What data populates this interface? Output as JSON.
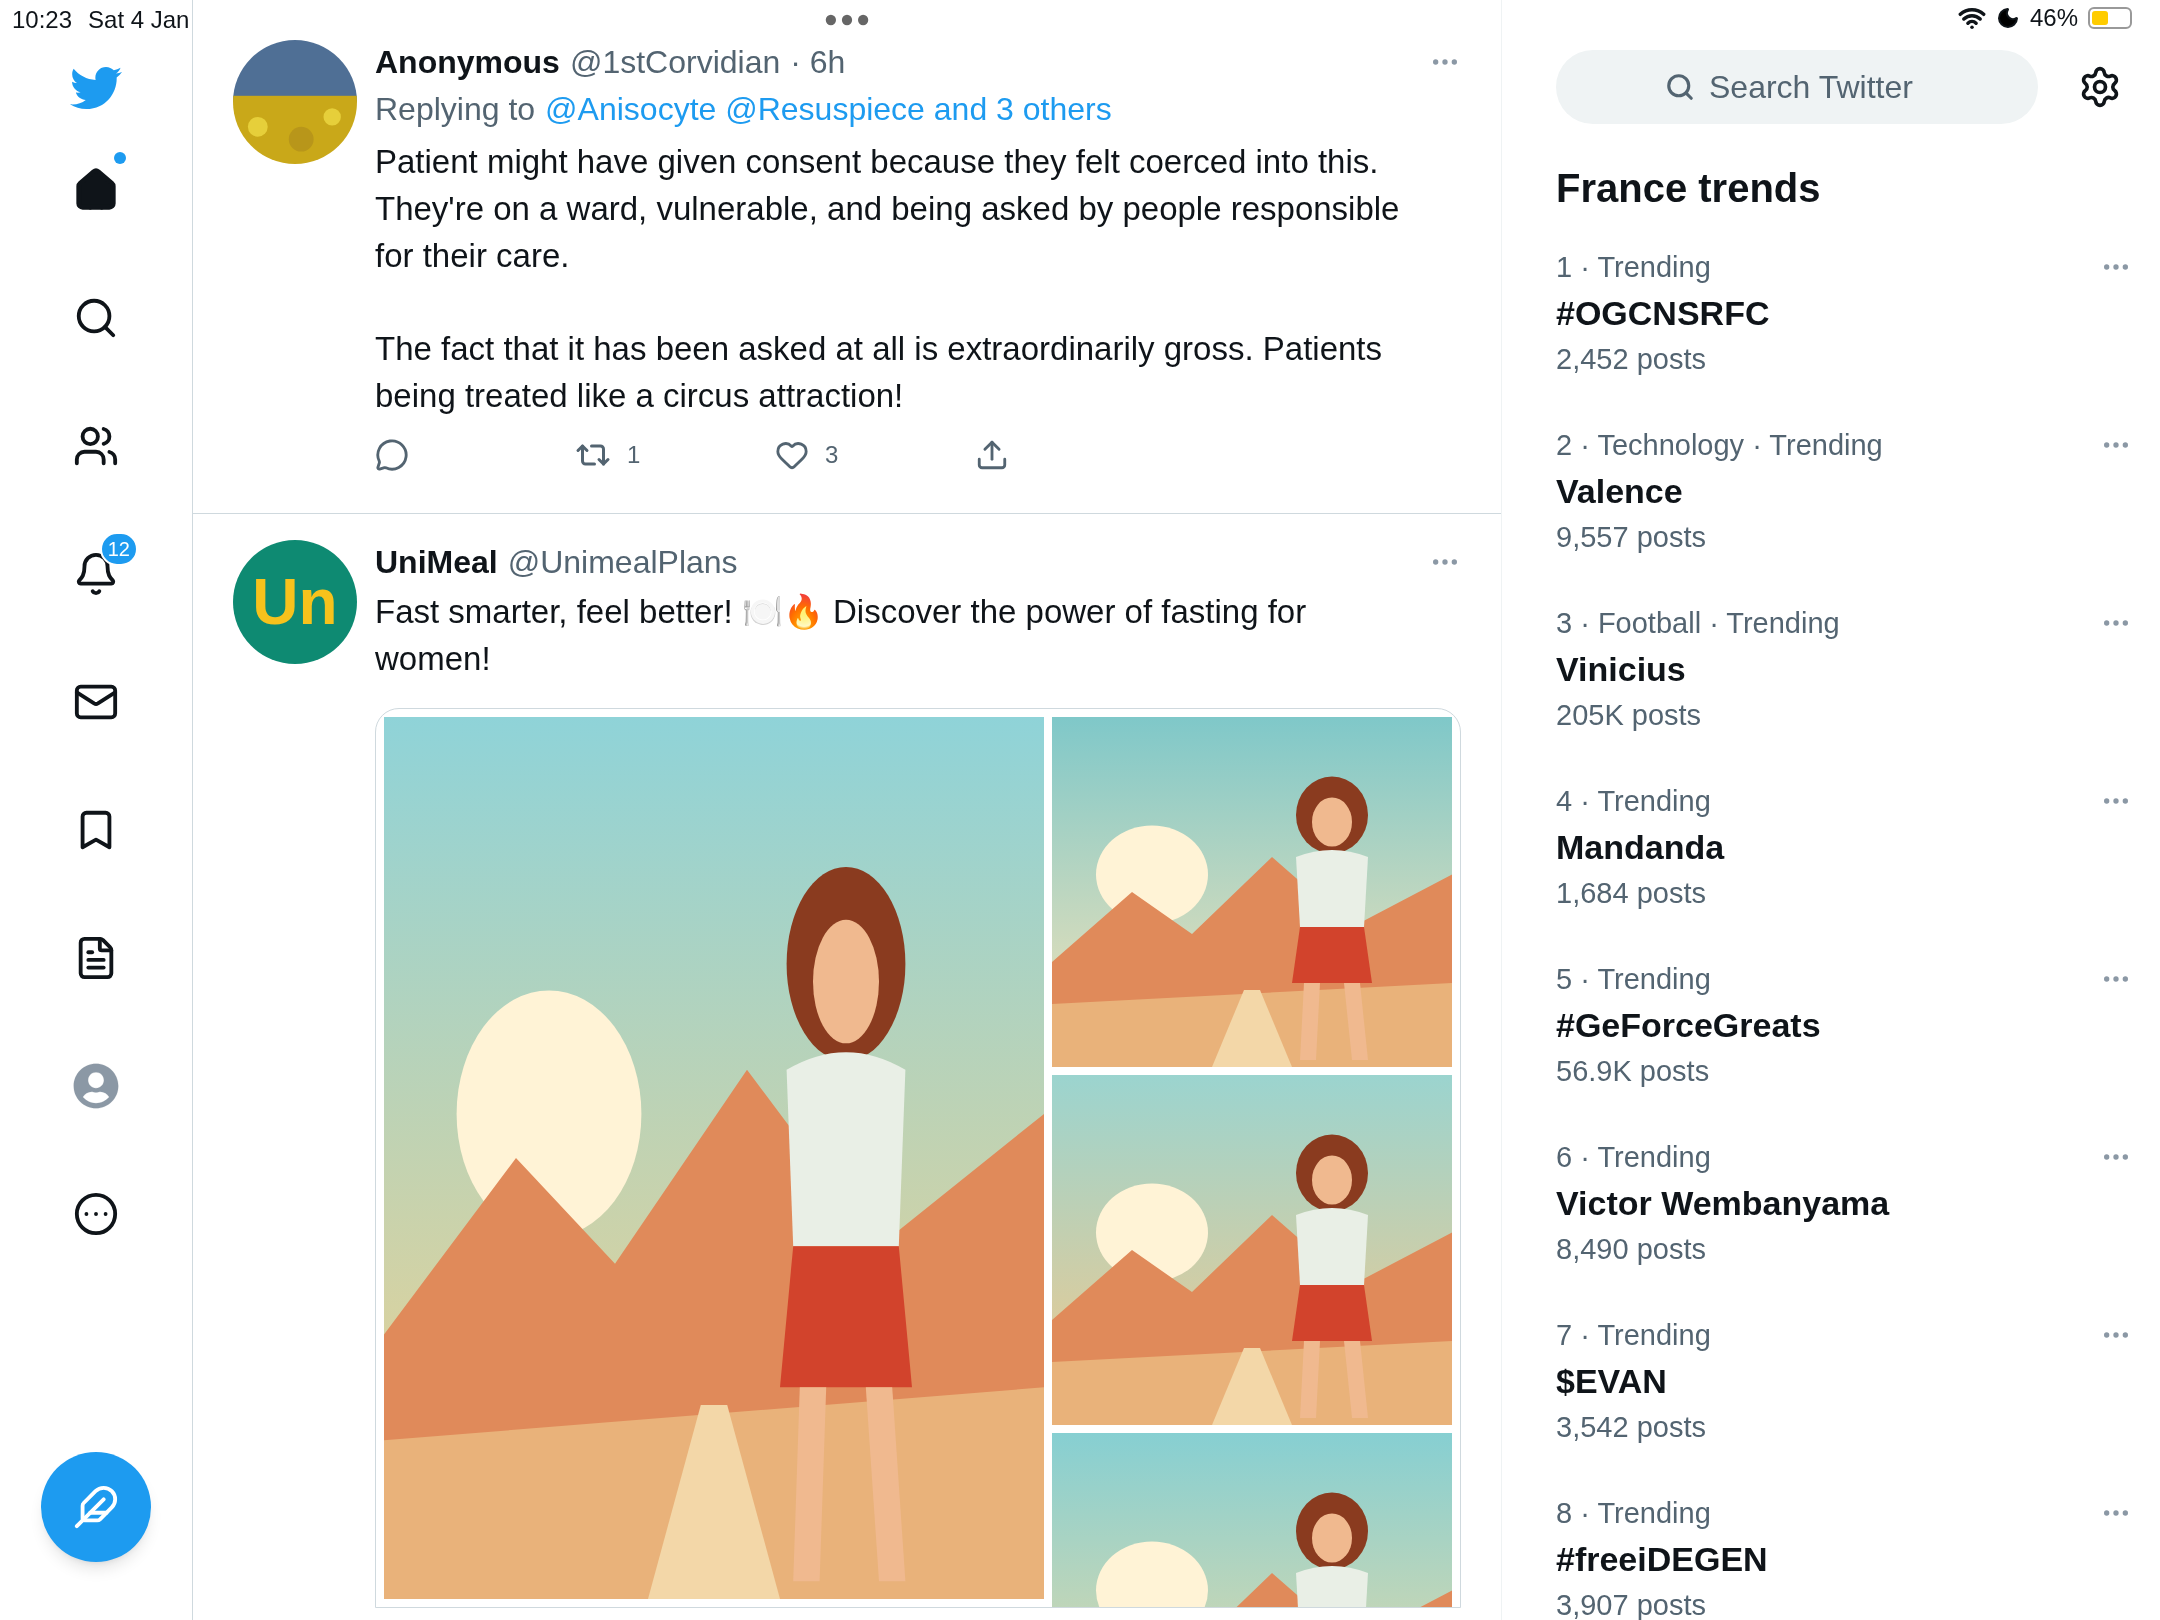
{
  "status_bar": {
    "time": "10:23",
    "date": "Sat 4 Jan",
    "battery": "46%"
  },
  "sidebar": {
    "items": [
      {
        "kind": "home",
        "selected": true,
        "dot": true
      },
      {
        "kind": "explore",
        "selected": false
      },
      {
        "kind": "communities",
        "selected": false
      },
      {
        "kind": "notifications",
        "selected": false,
        "badge": "12"
      },
      {
        "kind": "messages",
        "selected": false
      },
      {
        "kind": "bookmarks",
        "selected": false
      },
      {
        "kind": "lists",
        "selected": false
      },
      {
        "kind": "profile",
        "selected": false
      },
      {
        "kind": "more",
        "selected": false
      }
    ]
  },
  "tweets": [
    {
      "avatar": {
        "kind": "picture"
      },
      "name": "Anonymous",
      "handle": "@1stCorvidian",
      "time": "· 6h",
      "replying_label": "Replying to",
      "replying_to": "@Anisocyte @Resuspiece and 3 others",
      "paragraphs": [
        "Patient might have given consent because they felt coerced into this. They're on a ward, vulnerable, and being asked by people responsible for their care.",
        "The fact that it has been asked at all is extraordinarily gross. Patients being treated like a circus attraction!"
      ],
      "actions": {
        "retweets": "1",
        "likes": "3"
      }
    },
    {
      "avatar": {
        "kind": "logo",
        "text": "Un"
      },
      "name": "UniMeal",
      "handle": "@UnimealPlans",
      "paragraphs": [
        "Fast smarter, feel better! 🍽️🔥 Discover the power of fasting for women!"
      ],
      "media": [
        {
          "kind": "picture"
        },
        {
          "kind": "picture"
        },
        {
          "kind": "picture"
        },
        {
          "kind": "picture"
        }
      ]
    }
  ],
  "search": {
    "placeholder": "Search Twitter"
  },
  "trends": {
    "title": "France trends",
    "items": [
      {
        "meta": "1 · Trending",
        "name": "#OGCNSRFC",
        "posts": "2,452 posts"
      },
      {
        "meta": "2 · Technology · Trending",
        "name": "Valence",
        "posts": "9,557 posts"
      },
      {
        "meta": "3 · Football · Trending",
        "name": "Vinicius",
        "posts": "205K posts"
      },
      {
        "meta": "4 · Trending",
        "name": "Mandanda",
        "posts": "1,684 posts"
      },
      {
        "meta": "5 · Trending",
        "name": "#GeForceGreats",
        "posts": "56.9K posts"
      },
      {
        "meta": "6 · Trending",
        "name": "Victor Wembanyama",
        "posts": "8,490 posts"
      },
      {
        "meta": "7 · Trending",
        "name": "$EVAN",
        "posts": "3,542 posts"
      },
      {
        "meta": "8 · Trending",
        "name": "#freeiDEGEN",
        "posts": "3,907 posts"
      }
    ]
  }
}
